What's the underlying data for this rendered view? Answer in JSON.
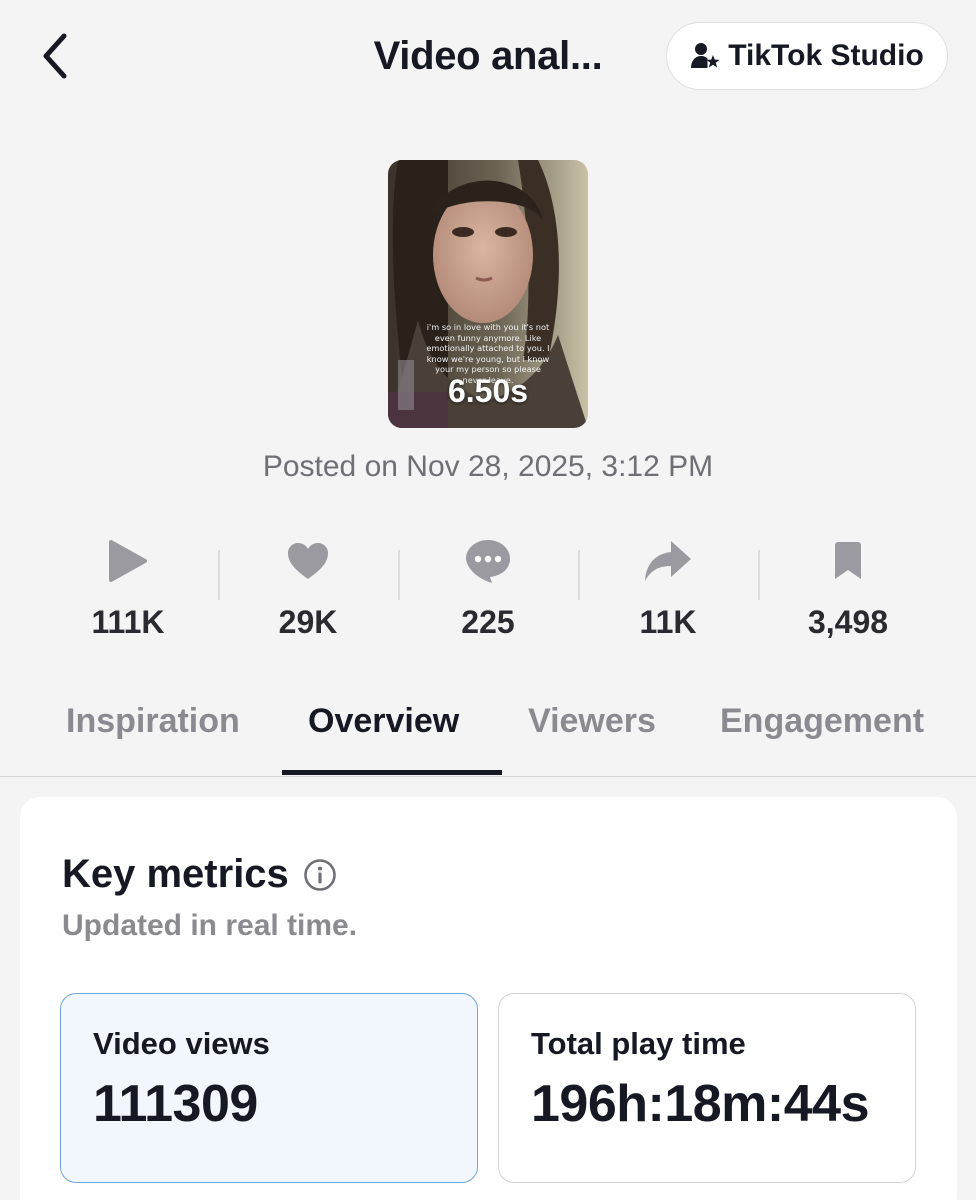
{
  "header": {
    "title": "Video anal...",
    "studio_button": "TikTok Studio"
  },
  "video": {
    "caption": "i'm so in love with you it's not even funny anymore. Like emotionally attached to you. I know we're young, but i know your my person so please never leave.",
    "duration": "6.50s",
    "posted": "Posted on Nov 28, 2025, 3:12 PM"
  },
  "stats": {
    "views": "111K",
    "likes": "29K",
    "comments": "225",
    "shares": "11K",
    "saves": "3,498"
  },
  "tabs": [
    {
      "label": "Inspiration",
      "active": false
    },
    {
      "label": "Overview",
      "active": true
    },
    {
      "label": "Viewers",
      "active": false
    },
    {
      "label": "Engagement",
      "active": false
    }
  ],
  "key_metrics": {
    "title": "Key metrics",
    "subtitle": "Updated in real time.",
    "cards": [
      {
        "label": "Video views",
        "value": "111309"
      },
      {
        "label": "Total play time",
        "value": "196h:18m:44s"
      }
    ]
  },
  "colors": {
    "background": "#f4f4f5",
    "text_primary": "#161823",
    "icon_gray": "#9a9aa0",
    "selected_border": "#6fa7dc",
    "selected_fill": "#f2f7fd"
  },
  "icons": {
    "back": "chevron-left-icon",
    "studio": "user-star-icon",
    "views": "play-icon",
    "likes": "heart-icon",
    "comments": "comment-bubble-icon",
    "shares": "share-arrow-icon",
    "saves": "bookmark-icon",
    "info": "info-circle-icon"
  }
}
